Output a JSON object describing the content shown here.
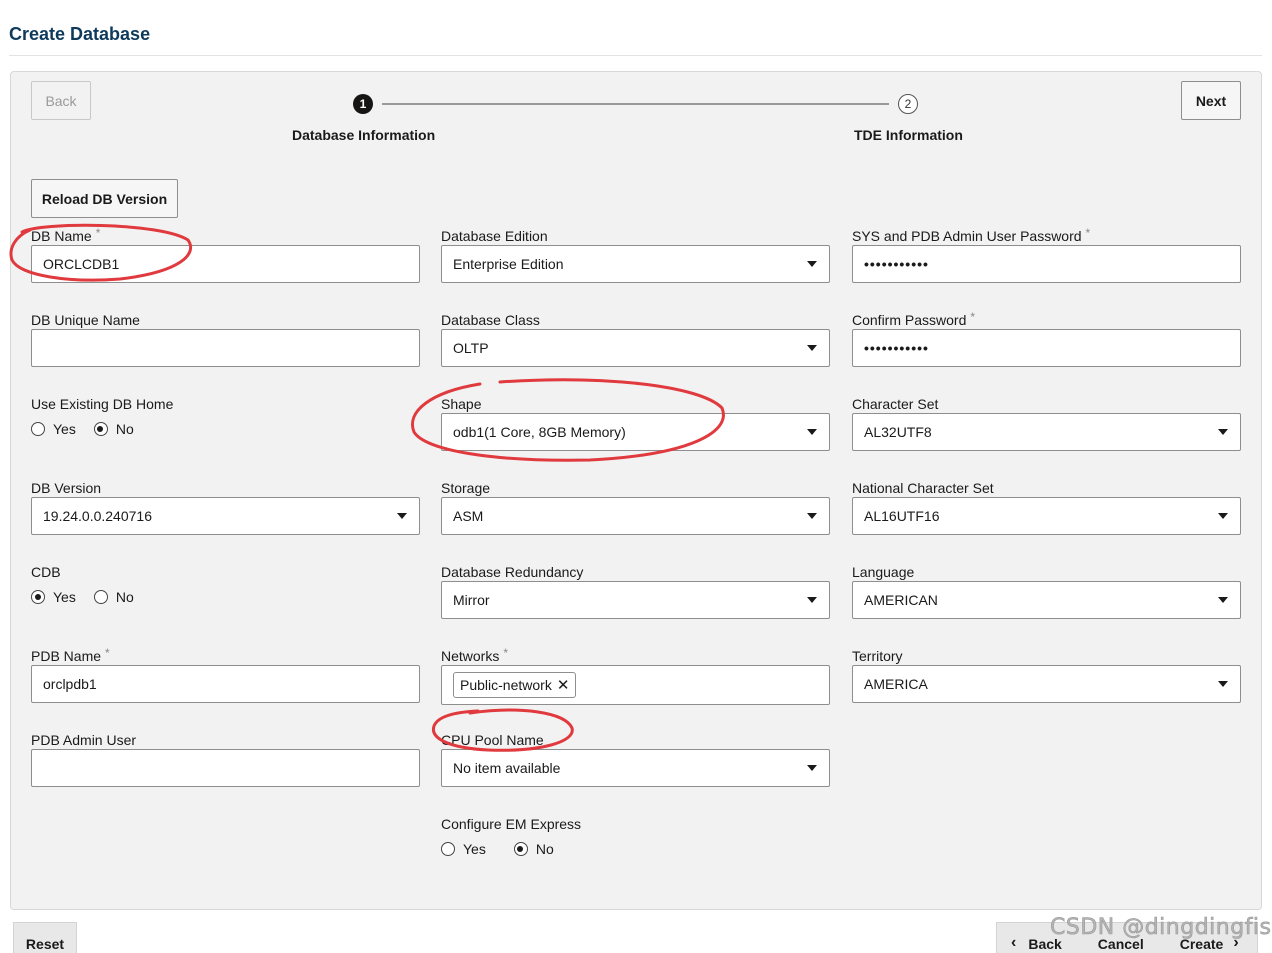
{
  "page": {
    "title": "Create Database"
  },
  "nav": {
    "back_label": "Back",
    "next_label": "Next"
  },
  "train": {
    "steps": [
      {
        "number": "1",
        "label": "Database Information"
      },
      {
        "number": "2",
        "label": "TDE Information"
      }
    ]
  },
  "reload_label": "Reload DB Version",
  "col1": {
    "db_name": {
      "label": "DB Name",
      "required": "*",
      "value": "ORCLCDB1"
    },
    "db_unique_name": {
      "label": "DB Unique Name",
      "value": ""
    },
    "use_existing_home": {
      "label": "Use Existing DB Home",
      "yes": "Yes",
      "no": "No",
      "selected": "No"
    },
    "db_version": {
      "label": "DB Version",
      "value": "19.24.0.0.240716"
    },
    "cdb": {
      "label": "CDB",
      "yes": "Yes",
      "no": "No",
      "selected": "Yes"
    },
    "pdb_name": {
      "label": "PDB Name",
      "required": "*",
      "value": "orclpdb1"
    },
    "pdb_admin_user": {
      "label": "PDB Admin User",
      "value": ""
    }
  },
  "col2": {
    "edition": {
      "label": "Database Edition",
      "value": "Enterprise Edition"
    },
    "db_class": {
      "label": "Database Class",
      "value": "OLTP"
    },
    "shape": {
      "label": "Shape",
      "value": "odb1(1 Core, 8GB Memory)"
    },
    "storage": {
      "label": "Storage",
      "value": "ASM"
    },
    "redundancy": {
      "label": "Database Redundancy",
      "value": "Mirror"
    },
    "networks": {
      "label": "Networks",
      "required": "*",
      "chip": "Public-network",
      "chip_remove": "✕"
    },
    "cpu_pool": {
      "label": "CPU Pool Name",
      "value": "No item available"
    },
    "em_express": {
      "label": "Configure EM Express",
      "yes": "Yes",
      "no": "No",
      "selected": "No"
    }
  },
  "col3": {
    "sys_password": {
      "label": "SYS and PDB Admin User Password",
      "required": "*",
      "value": "•••••••••••"
    },
    "confirm_password": {
      "label": "Confirm Password",
      "required": "*",
      "value": "•••••••••••"
    },
    "charset": {
      "label": "Character Set",
      "value": "AL32UTF8"
    },
    "national_charset": {
      "label": "National Character Set",
      "value": "AL16UTF16"
    },
    "language": {
      "label": "Language",
      "value": "AMERICAN"
    },
    "territory": {
      "label": "Territory",
      "value": "AMERICA"
    }
  },
  "footer": {
    "reset_label": "Reset",
    "back_label": "Back",
    "back_icon": "‹",
    "cancel_label": "Cancel",
    "create_label": "Create",
    "create_icon": "›"
  },
  "watermark": "CSDN @dingdingfish",
  "colors": {
    "title": "#0e3a5c",
    "annotation": "#e03a3e",
    "panel": "#f2f2f2"
  }
}
